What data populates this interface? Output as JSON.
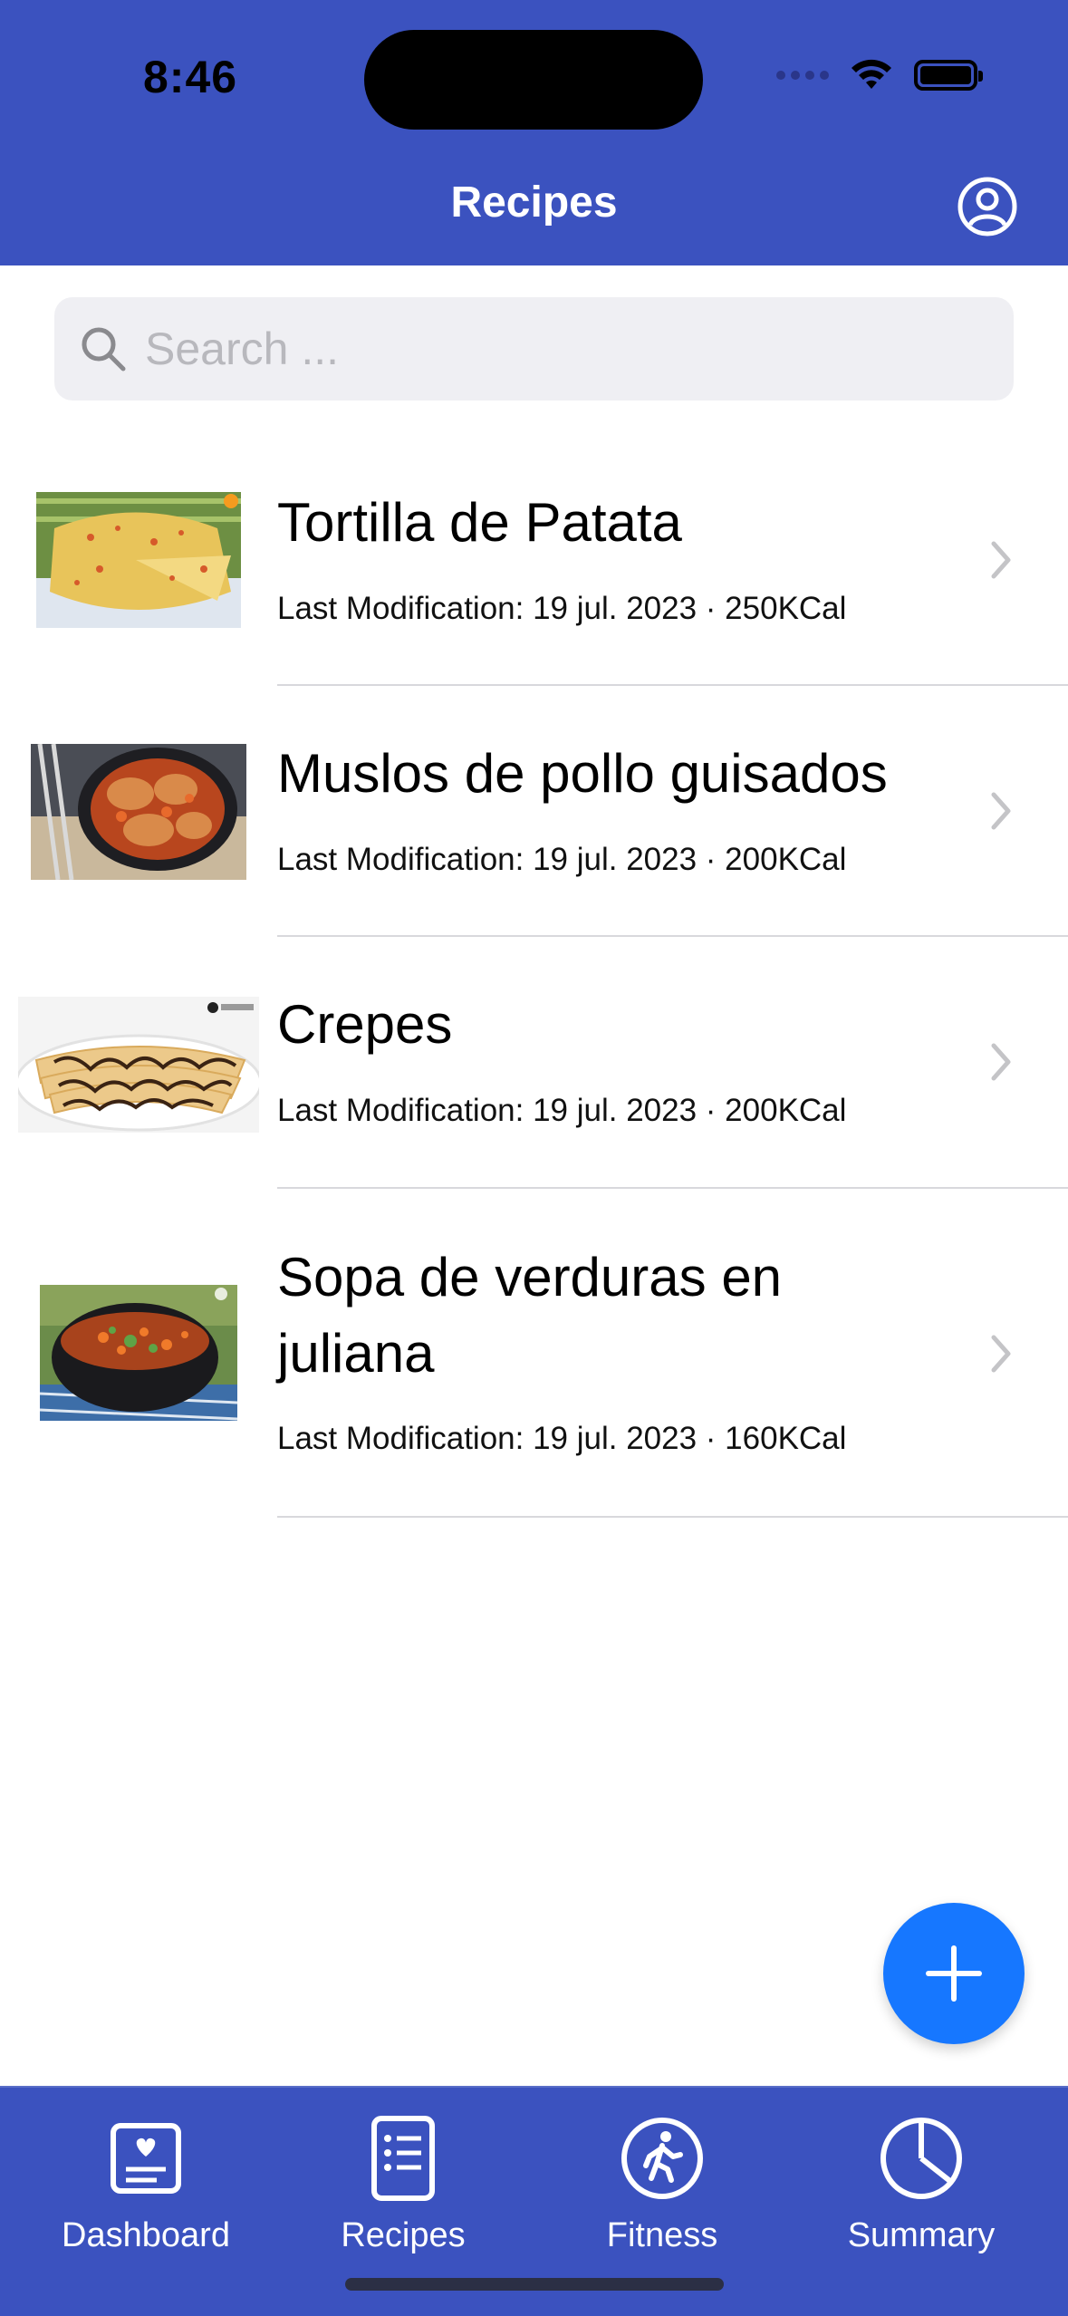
{
  "status_bar": {
    "time": "8:46"
  },
  "nav": {
    "title": "Recipes",
    "account_icon": "person-circle-icon"
  },
  "search": {
    "placeholder": "Search ...",
    "value": ""
  },
  "recipes": [
    {
      "name": "Tortilla de Patata",
      "subtitle": "Last Modification: 19 jul. 2023 · 250KCal"
    },
    {
      "name": "Muslos de pollo guisados",
      "subtitle": "Last Modification: 19 jul. 2023 · 200KCal"
    },
    {
      "name": "Crepes",
      "subtitle": "Last Modification: 19 jul. 2023 · 200KCal"
    },
    {
      "name": "Sopa de verduras en juliana",
      "subtitle": "Last Modification: 19 jul. 2023 · 160KCal"
    }
  ],
  "fab": {
    "icon": "plus-icon"
  },
  "tabs": [
    {
      "label": "Dashboard",
      "icon": "dashboard-card-icon"
    },
    {
      "label": "Recipes",
      "icon": "list-document-icon"
    },
    {
      "label": "Fitness",
      "icon": "figure-walk-icon"
    },
    {
      "label": "Summary",
      "icon": "pie-chart-icon"
    }
  ],
  "colors": {
    "header": "#3b52bf",
    "fab": "#1677ff",
    "search_bg": "#efeff3"
  }
}
